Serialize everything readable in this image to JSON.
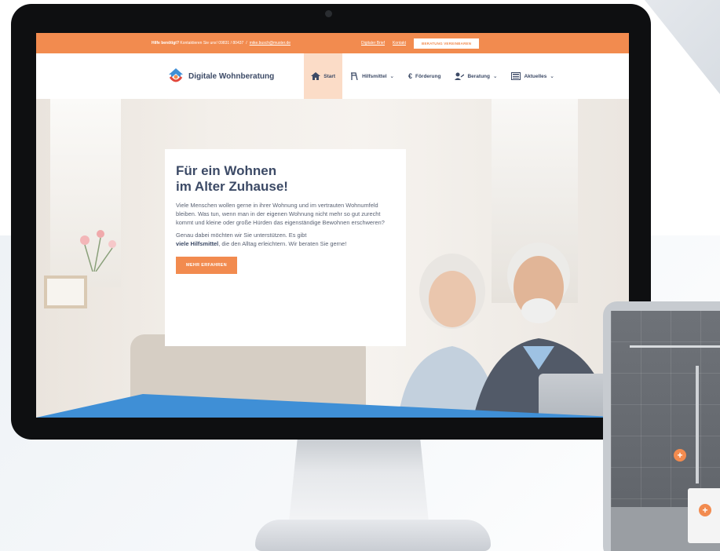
{
  "topbar": {
    "help_bold": "Hilfe benötigt?",
    "help_text": "Kontaktieren Sie uns! 09831 / 80437",
    "email": "mike.busch@muster.de",
    "link_digital": "Digitaler Brief",
    "link_contact": "Kontakt",
    "cta": "BERATUNG VEREINBAREN"
  },
  "nav": {
    "logo_text": "Digitale Wohnberatung",
    "items": [
      {
        "label": "Start",
        "icon": "home-icon"
      },
      {
        "label": "Hilfsmittel",
        "icon": "walker-icon"
      },
      {
        "label": "Förderung",
        "icon": "euro-icon"
      },
      {
        "label": "Beratung",
        "icon": "user-icon"
      },
      {
        "label": "Aktuelles",
        "icon": "newspaper-icon"
      }
    ]
  },
  "hero": {
    "title_line1": "Für ein Wohnen",
    "title_line2": "im Alter Zuhause!",
    "paragraph1": "Viele Menschen wollen gerne in ihrer Wohnung und im vertrauten Wohnumfeld bleiben. Was tun, wenn man in der eigenen Wohnung nicht mehr so gut zurecht kommt und kleine oder große Hürden das eigenständige Bewohnen erschweren?",
    "paragraph2_pre": "Genau dabei möchten wir Sie unterstützen. Es gibt",
    "paragraph2_bold": "viele Hilfsmittel",
    "paragraph2_post": ", die den Alltag erleichtern. Wir beraten Sie gerne!",
    "button": "MEHR ERFAHREN"
  },
  "tablet": {
    "hotspot": "+"
  },
  "colors": {
    "accent": "#f28b4f",
    "navy": "#3c4a66",
    "blue": "#3f8fd6"
  }
}
